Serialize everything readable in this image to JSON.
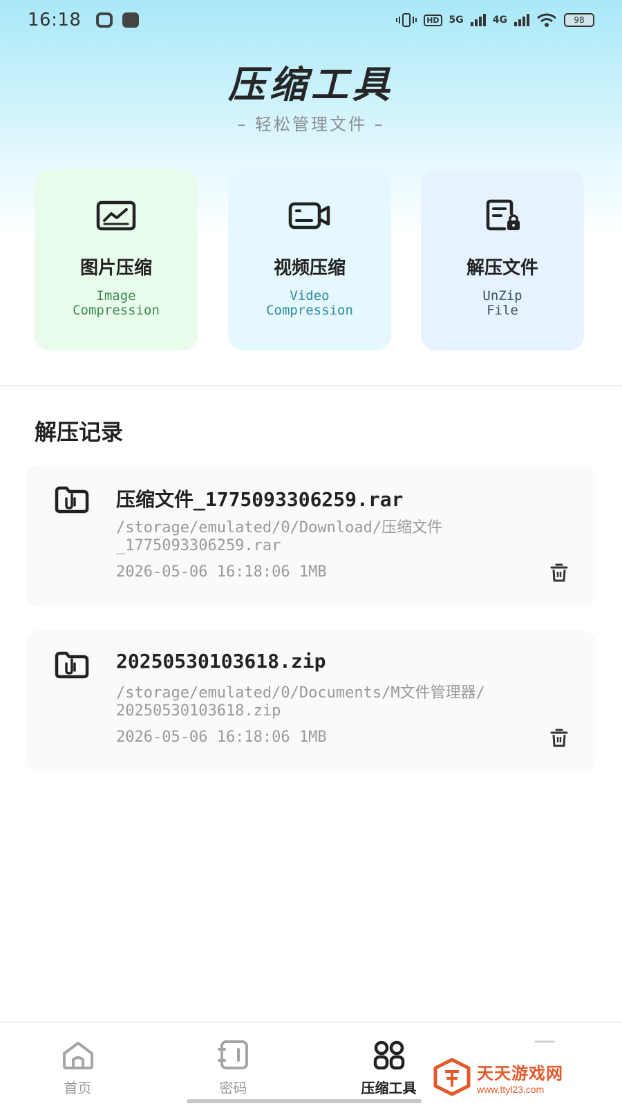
{
  "status_bar": {
    "time": "16:18",
    "hd_label": "HD",
    "net_5g": "5G",
    "net_4g": "4G",
    "battery": "98"
  },
  "header": {
    "title": "压缩工具",
    "subtitle": "– 轻松管理文件 –"
  },
  "tools": [
    {
      "name": "图片压缩",
      "en": "Image\nCompression",
      "icon": "image-icon"
    },
    {
      "name": "视频压缩",
      "en": "Video\nCompression",
      "icon": "video-camera-icon"
    },
    {
      "name": "解压文件",
      "en": "UnZip\nFile",
      "icon": "file-lock-icon"
    }
  ],
  "history": {
    "title": "解压记录",
    "items": [
      {
        "name": "压缩文件_1775093306259.rar",
        "path": "/storage/emulated/0/Download/压缩文件\n_1775093306259.rar",
        "meta": "2026-05-06 16:18:06 1MB",
        "icon": "archive-file-icon"
      },
      {
        "name": "20250530103618.zip",
        "path": "/storage/emulated/0/Documents/M文件管理器/\n20250530103618.zip",
        "meta": "2026-05-06 16:18:06 1MB",
        "icon": "archive-file-icon"
      }
    ]
  },
  "tabbar": {
    "tabs": [
      {
        "label": "首页",
        "icon": "home-icon",
        "active": false
      },
      {
        "label": "密码",
        "icon": "password-icon",
        "active": false
      },
      {
        "label": "压缩工具",
        "icon": "grid-icon",
        "active": true
      },
      {
        "label": "",
        "icon": "profile-icon",
        "active": false
      }
    ]
  },
  "watermark": {
    "name": "天天游戏网",
    "url": "www.ttyl23.com"
  },
  "colors": {
    "accent_orange": "#e25a2a",
    "card_green": "#e9fbeb",
    "card_cyan": "#e5f8fd",
    "card_blue": "#e6f2fd"
  }
}
